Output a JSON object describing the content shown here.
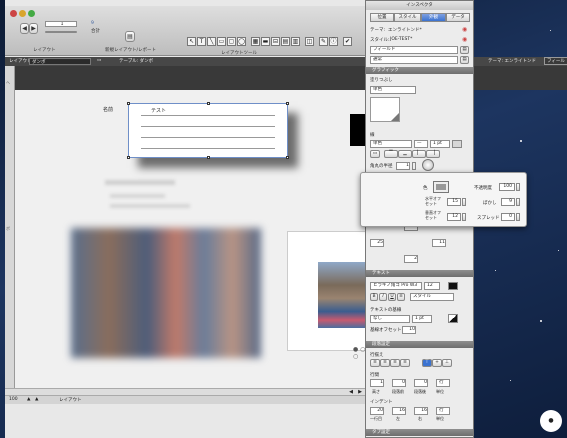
{
  "main": {
    "toolbar": {
      "page_value": "1",
      "total_count": "9",
      "total_label": "合計",
      "layouts_label": "レイアウト",
      "new_layout_label": "新規レイアウト/レポート",
      "layout_tools_label": "レイアウトツール"
    },
    "layout_bar": {
      "layout_label": "レイアウト:",
      "layout_value": "ダンボ",
      "table_label": "テーブル: ダンボ",
      "theme_label": "テーマ: エンライトンド",
      "field_button": "フィール"
    },
    "canvas": {
      "name_label": "名前",
      "field_text": "テスト"
    },
    "status": {
      "zoom": "100",
      "mode": "レイアウト"
    }
  },
  "inspector": {
    "title": "インスペクタ",
    "tabs": [
      "位置",
      "スタイル",
      "外観",
      "データ"
    ],
    "active_tab": 2,
    "theme_label": "テーマ:",
    "theme_value": "エンライトンド*",
    "style_label": "スタイル:",
    "style_value": "JOE-TEST*",
    "field_select": "フィールド",
    "state_select": "通常",
    "sections": {
      "graphic": "グラフィック",
      "advanced": "詳細なグラフィック",
      "text": "テキスト",
      "paragraph": "段落設定",
      "tab": "タブ設定"
    },
    "fill_label": "塗りつぶし",
    "fill_value": "単色",
    "line_label": "線",
    "line_style": "単色",
    "line_width": "1 pt",
    "radius_label": "角丸の半径",
    "radius_value": "1",
    "shadow_label": "影",
    "outer_shadow": "外部の影",
    "inner_shadow": "内部の影",
    "padding_label": "パディング",
    "padding_top": "2",
    "padding_left": "25",
    "padding_right": "11",
    "padding_bottom": "2",
    "font_value": "ヒラギノ角ゴ Pro W3",
    "font_size": "12",
    "style_popup": "スタイル",
    "underline_label": "テキストの基線",
    "underline_value": "なし",
    "underline_width": "1 pt",
    "baseline_label": "基線オフセット:",
    "baseline_value": "10",
    "align_label": "行揃え",
    "spacing_label": "行間",
    "spacing_values": [
      "1",
      "0",
      "0",
      "行"
    ],
    "spacing_labels": [
      "高さ",
      "段落前",
      "段落後",
      "単位"
    ],
    "indent_label": "インデント",
    "indent_values": [
      "20",
      "16",
      "16",
      "行"
    ],
    "indent_labels": [
      "一行目",
      "左",
      "右",
      "単位"
    ]
  },
  "popover": {
    "color_label": "色",
    "blur_label": "不透明度",
    "blur_value": "100",
    "h_offset_label": "水平オフセット",
    "h_offset_value": "15",
    "v_offset_label": "垂直オフセット",
    "v_offset_value": "12",
    "blur2_label": "ぼかし",
    "blur2_value": "9",
    "spread_label": "スプレッド",
    "spread_value": "0"
  },
  "colors": {
    "desktop": "#1d3560",
    "panel_bg": "#ececec",
    "section_header": "#7a7a7a",
    "accent_blue": "#3b73d1"
  }
}
